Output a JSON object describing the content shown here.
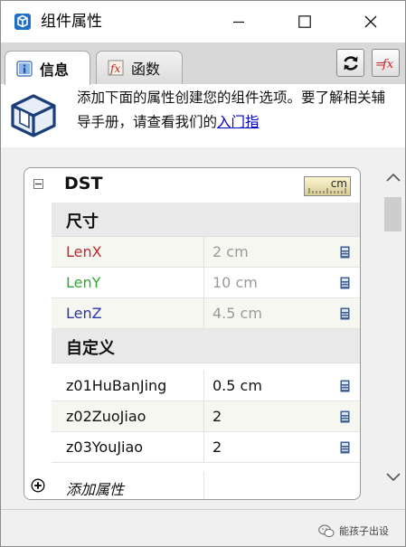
{
  "window": {
    "title": "组件属性",
    "icon": "sketchup-component-icon",
    "buttons": [
      "minimize-icon",
      "maximize-icon",
      "close-icon"
    ]
  },
  "tabs": [
    {
      "label": "信息",
      "icon": "info-icon",
      "active": true
    },
    {
      "label": "函数",
      "icon": "function-icon",
      "active": false
    }
  ],
  "toolbar": {
    "refresh_icon": "refresh-icon",
    "formula_icon": "formula-icon"
  },
  "banner": {
    "text": "添加下面的属性创建您的组件选项。要了解相关辅导手册，请查看我们的",
    "link": "入门指"
  },
  "component": {
    "name": "DST",
    "unit": "cm",
    "sections": [
      {
        "title": "尺寸",
        "rows": [
          {
            "name": "LenX",
            "value": "2 cm",
            "color": "#c0282d",
            "readonly": true
          },
          {
            "name": "LenY",
            "value": "10 cm",
            "color": "#2ea82e",
            "readonly": true
          },
          {
            "name": "LenZ",
            "value": "4.5 cm",
            "color": "#2a35a8",
            "readonly": true
          }
        ]
      },
      {
        "title": "自定义",
        "rows": [
          {
            "name": "z01HuBanJing",
            "value": "0.5 cm"
          },
          {
            "name": "z02ZuoJiao",
            "value": "2"
          },
          {
            "name": "z03YouJiao",
            "value": "2"
          }
        ]
      }
    ],
    "add_label": "添加属性"
  },
  "statusbar": {
    "watermark": "能孩子出设"
  }
}
